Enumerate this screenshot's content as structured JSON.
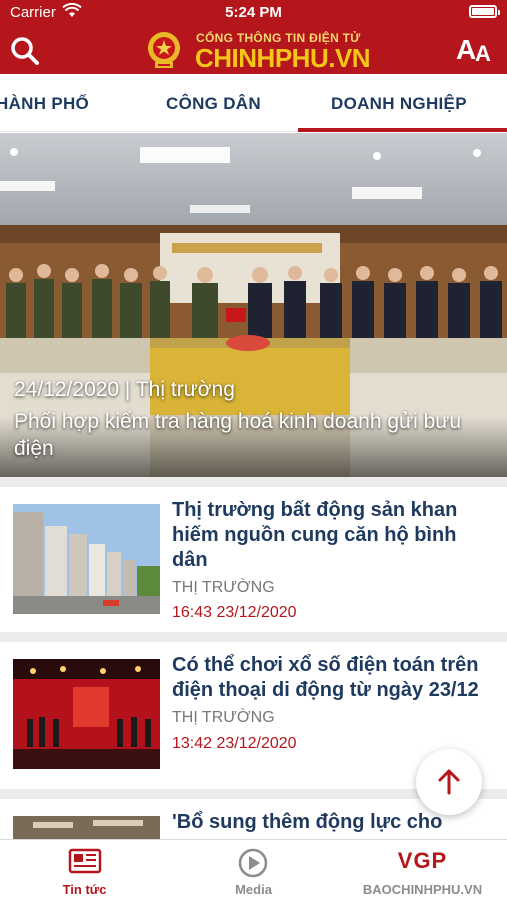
{
  "status_bar": {
    "carrier": "Carrier",
    "time": "5:24 PM"
  },
  "header": {
    "subtitle": "CỔNG THÔNG TIN ĐIỆN TỬ",
    "brand": "CHINHPHU.VN",
    "font_size_big": "A",
    "font_size_small": "A"
  },
  "tabs": [
    {
      "label": "HÀNH PHỐ"
    },
    {
      "label": "CÔNG DÂN"
    },
    {
      "label": "DOANH NGHIỆP",
      "active": true
    }
  ],
  "hero": {
    "meta": "24/12/2020 | Thị trường",
    "title": "Phối hợp kiểm tra hàng hoá kinh doanh gửi bưu điện"
  },
  "articles": [
    {
      "title": "Thị trường bất động sản khan hiếm nguồn cung căn hộ bình dân",
      "category": "THỊ TRƯỜNG",
      "time": "16:43 23/12/2020"
    },
    {
      "title": "Có thể chơi xổ số điện toán trên điện thoại di động từ ngày 23/12",
      "category": "THỊ TRƯỜNG",
      "time": "13:42 23/12/2020"
    },
    {
      "title": "'Bổ sung thêm động lực cho"
    }
  ],
  "bottom_nav": [
    {
      "label": "Tin tức",
      "icon": "newspaper-icon",
      "active": true
    },
    {
      "label": "Media",
      "icon": "play-icon"
    },
    {
      "label": "BAOCHINHPHU.VN",
      "logo_text": "VGP"
    }
  ],
  "colors": {
    "brand_red": "#b5161c",
    "brand_gold": "#f5c518",
    "navy_text": "#1f3a5f",
    "time_red": "#b5161c"
  }
}
